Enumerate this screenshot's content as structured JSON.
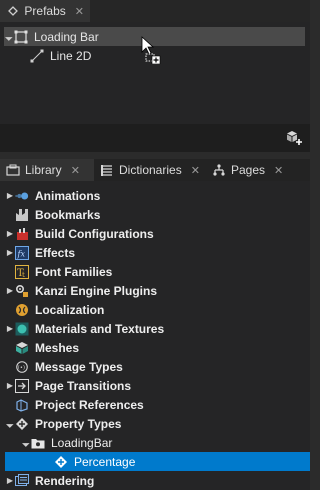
{
  "prefabs": {
    "tab_label": "Prefabs",
    "close": "✕",
    "items": [
      {
        "label": "Loading Bar",
        "icon": "node2d-icon"
      },
      {
        "label": "Line 2D",
        "icon": "line2d-icon"
      }
    ]
  },
  "library_tabs": [
    {
      "label": "Library",
      "close": "✕"
    },
    {
      "label": "Dictionaries",
      "close": "✕"
    },
    {
      "label": "Pages",
      "close": "✕"
    }
  ],
  "library": {
    "items": [
      {
        "label": "Animations",
        "icon": "animations-icon"
      },
      {
        "label": "Bookmarks",
        "icon": "bookmarks-icon"
      },
      {
        "label": "Build Configurations",
        "icon": "build-configurations-icon"
      },
      {
        "label": "Effects",
        "icon": "effects-icon"
      },
      {
        "label": "Font Families",
        "icon": "font-families-icon"
      },
      {
        "label": "Kanzi Engine Plugins",
        "icon": "plugins-icon"
      },
      {
        "label": "Localization",
        "icon": "localization-icon"
      },
      {
        "label": "Materials and Textures",
        "icon": "materials-icon"
      },
      {
        "label": "Meshes",
        "icon": "meshes-icon"
      },
      {
        "label": "Message Types",
        "icon": "message-types-icon"
      },
      {
        "label": "Page Transitions",
        "icon": "page-transitions-icon"
      },
      {
        "label": "Project References",
        "icon": "project-references-icon"
      },
      {
        "label": "Property Types",
        "icon": "property-types-icon"
      },
      {
        "label": "LoadingBar",
        "icon": "folder-icon"
      },
      {
        "label": "Percentage",
        "icon": "property-icon"
      },
      {
        "label": "Rendering",
        "icon": "rendering-icon"
      }
    ]
  },
  "colors": {
    "accent": "#007acc",
    "hover": "#4a4a4a",
    "background": "#252526"
  }
}
